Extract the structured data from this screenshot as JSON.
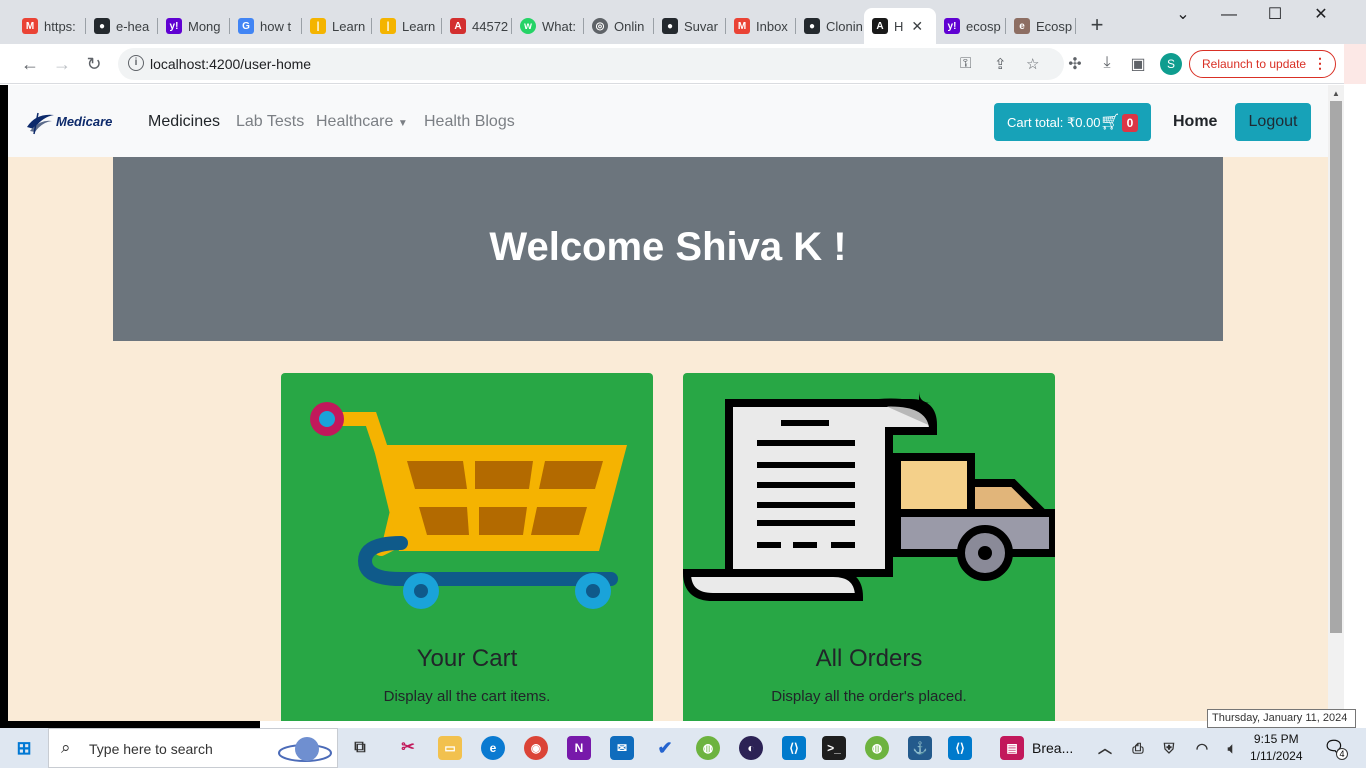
{
  "browser": {
    "tabs": [
      {
        "title": "https:",
        "icon": "gmail-icon",
        "color": "#ea4335"
      },
      {
        "title": "e-hea",
        "icon": "github-icon",
        "color": "#24292e"
      },
      {
        "title": "Mong",
        "icon": "yahoo-icon",
        "color": "#6001d2"
      },
      {
        "title": "how t",
        "icon": "google-icon",
        "color": "#4285f4"
      },
      {
        "title": "Learn",
        "icon": "analytics-icon",
        "color": "#f4b400"
      },
      {
        "title": "Learn",
        "icon": "analytics-icon",
        "color": "#f4b400"
      },
      {
        "title": "44572",
        "icon": "pdf-icon",
        "color": "#d32f2f"
      },
      {
        "title": "What:",
        "icon": "whatsapp-icon",
        "color": "#25d366"
      },
      {
        "title": "Onlin",
        "icon": "globe-icon",
        "color": "#5f6368"
      },
      {
        "title": "Suvar",
        "icon": "github-icon",
        "color": "#24292e"
      },
      {
        "title": "Inbox",
        "icon": "gmail-icon",
        "color": "#ea4335"
      },
      {
        "title": "Clonin",
        "icon": "github-icon",
        "color": "#24292e"
      },
      {
        "title": "H",
        "icon": "angular-icon",
        "color": "#1a1a1a"
      },
      {
        "title": "ecosp",
        "icon": "yahoo-icon",
        "color": "#6001d2"
      },
      {
        "title": "Ecosp",
        "icon": "ecosp-icon",
        "color": "#8d6e63"
      }
    ],
    "url": "localhost:4200/user-home",
    "profile_initial": "S",
    "relaunch_label": "Relaunch to update"
  },
  "navbar": {
    "brand": "Medicare",
    "links": [
      "Medicines",
      "Lab Tests",
      "Healthcare",
      "Health Blogs"
    ],
    "cart_label": "Cart total: ₹0.00",
    "cart_count": "0",
    "home_label": "Home",
    "logout_label": "Logout"
  },
  "jumbotron": {
    "heading": "Welcome Shiva K !"
  },
  "cards": [
    {
      "title": "Your Cart",
      "text": "Display all the cart items."
    },
    {
      "title": "All Orders",
      "text": "Display all the order's placed."
    }
  ],
  "taskbar": {
    "search_placeholder": "Type here to search",
    "app_label": "Brea...",
    "time": "9:15 PM",
    "date": "1/11/2024",
    "notifications": "4",
    "tooltip": "Thursday, January 11, 2024"
  },
  "colors": {
    "page_bg": "#faebd7",
    "jumbotron_bg": "#6c757d",
    "card_bg": "#28a745",
    "info_button": "#17a2b8",
    "badge": "#dc3545"
  }
}
